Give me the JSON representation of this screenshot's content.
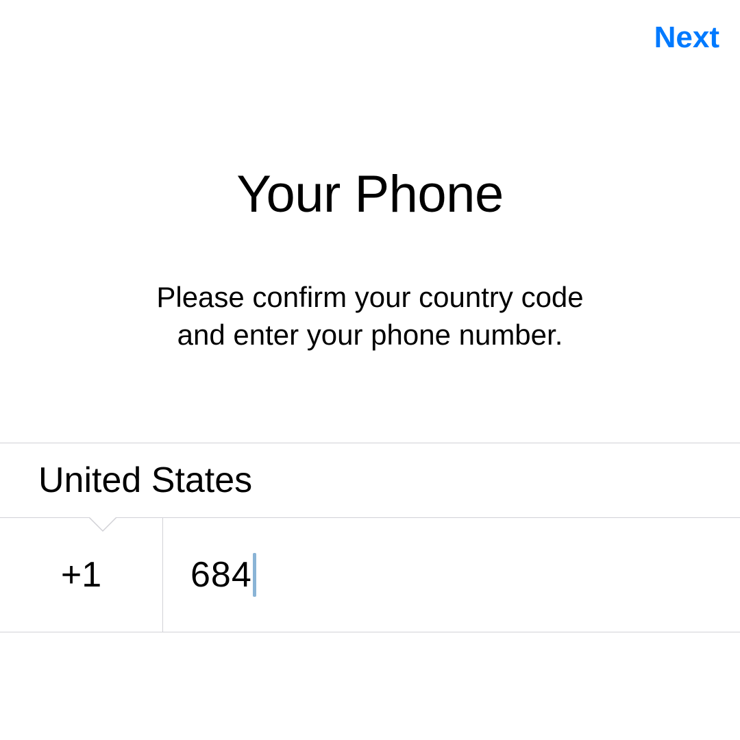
{
  "nav": {
    "next_label": "Next"
  },
  "header": {
    "title": "Your Phone",
    "subtitle_line1": "Please confirm your country code",
    "subtitle_line2": "and enter your phone number."
  },
  "form": {
    "country_name": "United States",
    "country_code": "+1",
    "phone_value": "684"
  },
  "colors": {
    "accent": "#007aff",
    "separator": "#d1d1d6",
    "caret": "#8ab4d6"
  }
}
